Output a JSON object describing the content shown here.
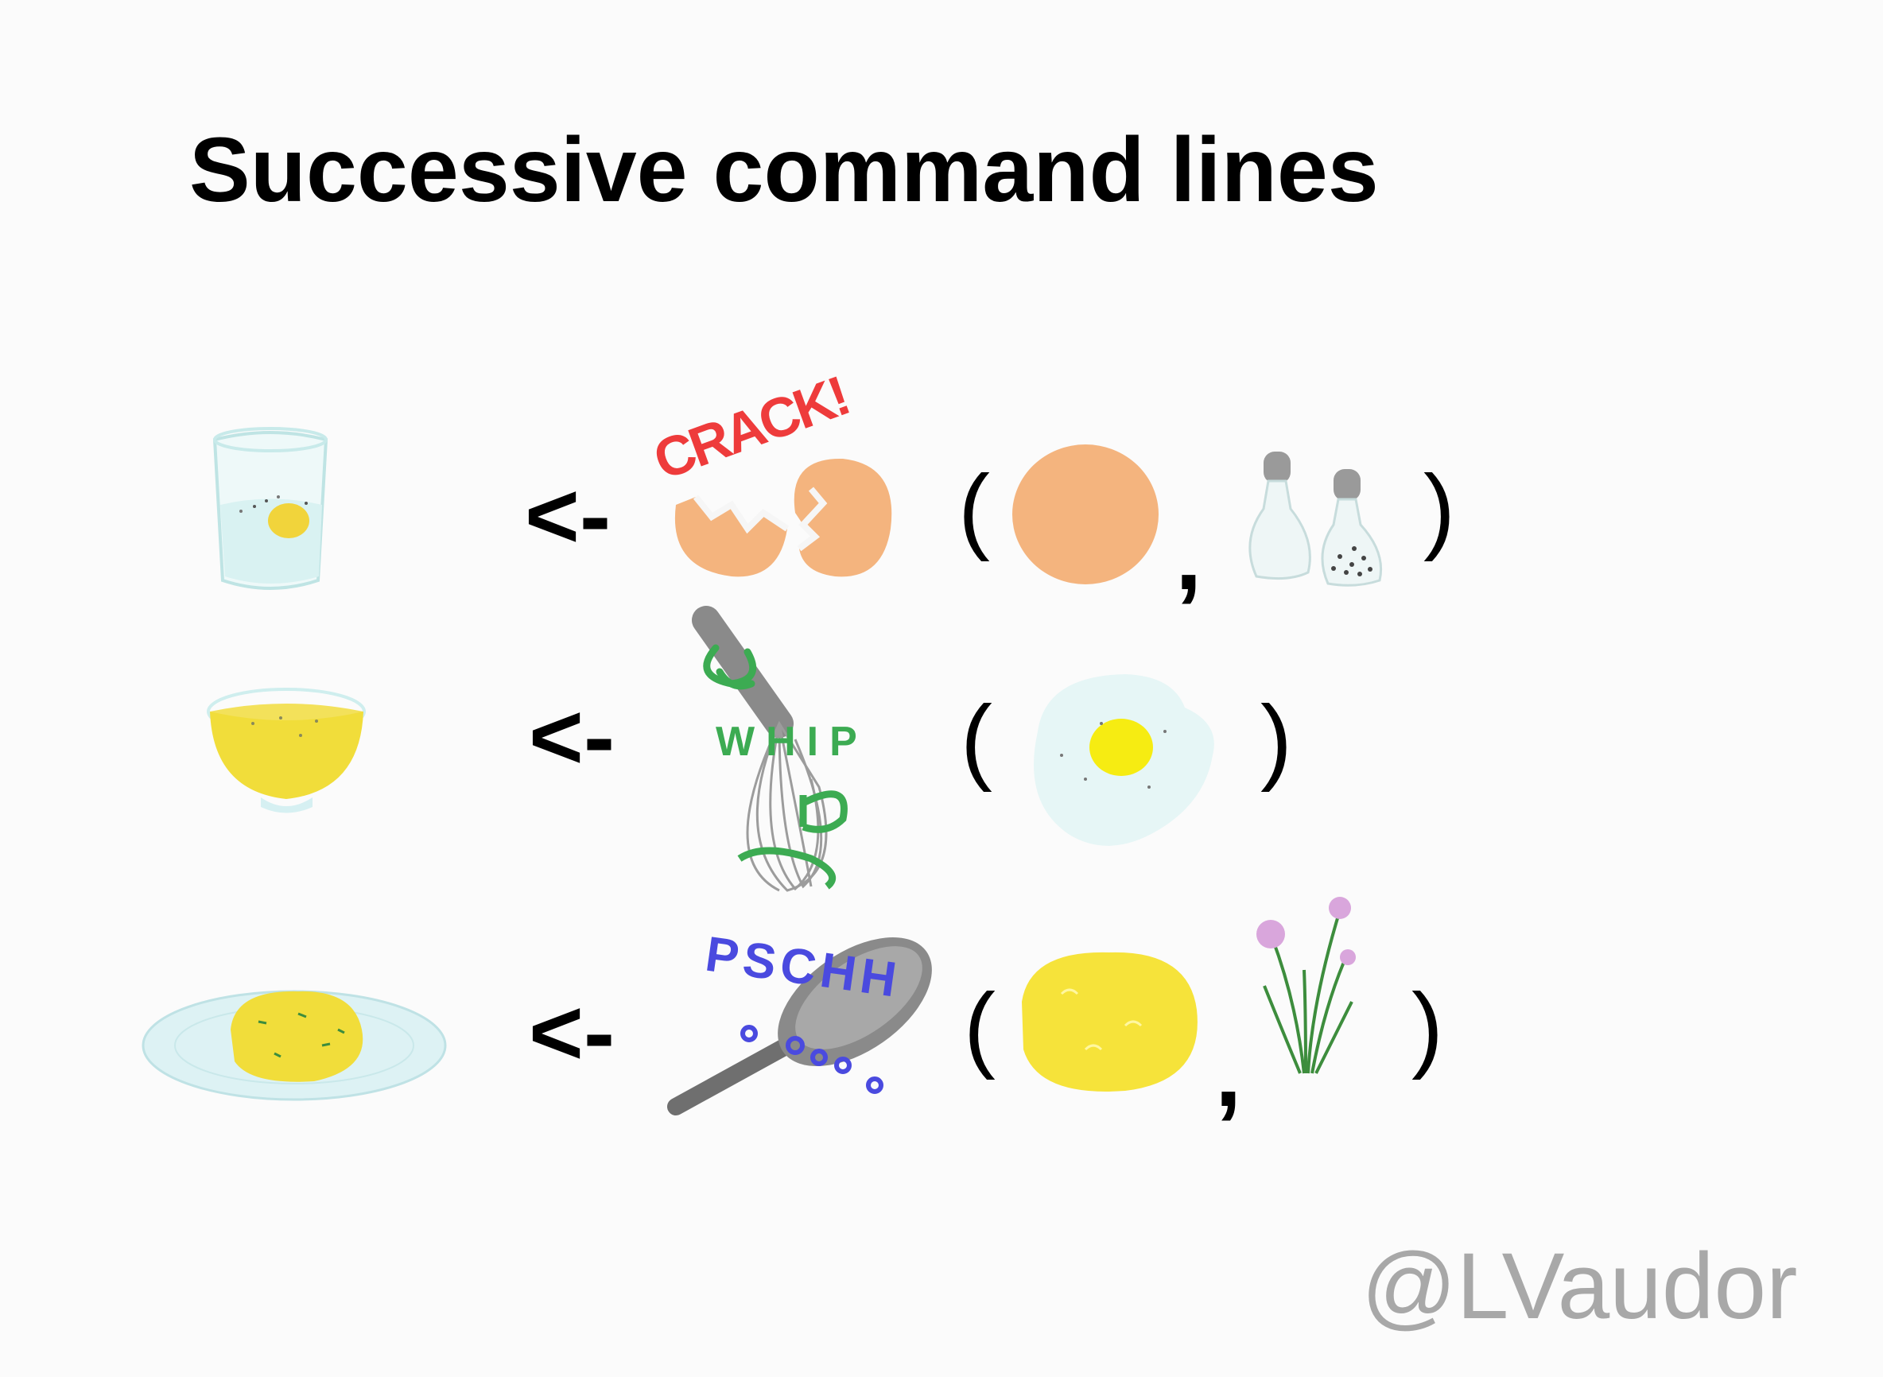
{
  "title": "Successive command lines",
  "watermark": "@LVaudor",
  "rows": [
    {
      "result_icon": "glass-of-raw-egg-icon",
      "operator": "<-",
      "function_icon": "cracked-egg-shell-icon",
      "function_word": "CRACK!",
      "open_paren": "(",
      "close_paren": ")",
      "separator": ",",
      "args": [
        "whole-egg-icon",
        "salt-and-pepper-shakers-icon"
      ],
      "word_color": "#ee3b3b"
    },
    {
      "result_icon": "bowl-of-beaten-egg-icon",
      "operator": "<-",
      "function_icon": "whisk-icon",
      "function_word": "WHIP",
      "open_paren": "(",
      "close_paren": ")",
      "args": [
        "fried-egg-icon"
      ],
      "word_color": "#3cab52"
    },
    {
      "result_icon": "plate-of-scrambled-egg-icon",
      "operator": "<-",
      "function_icon": "frying-pan-icon",
      "function_word": "PSCHH",
      "open_paren": "(",
      "close_paren": ")",
      "separator": ",",
      "args": [
        "beaten-egg-blob-icon",
        "chives-icon"
      ],
      "word_color": "#4a4adf"
    }
  ],
  "colors": {
    "eggshell": "#f4b47e",
    "yolk": "#f1dd3a",
    "glass": "#cdeeee",
    "plate": "#d6f0f2",
    "pan": "#7b7b7b",
    "chive": "#3d8d3d",
    "chive_flower": "#d9a6dc"
  }
}
